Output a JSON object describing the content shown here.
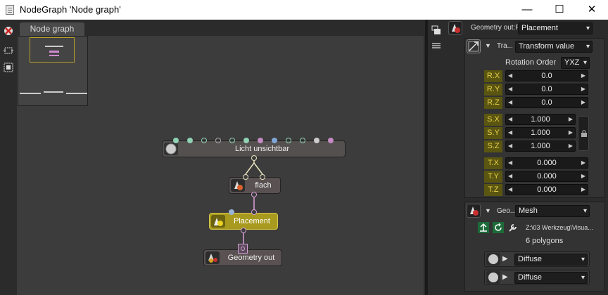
{
  "window": {
    "title": "NodeGraph 'Node graph'",
    "minimize": "—",
    "maximize": "☐",
    "close": "✕"
  },
  "graph": {
    "tab_label": "Node graph",
    "nodes": {
      "licht": "Licht unsichtbar",
      "flach": "flach",
      "placement": "Placement",
      "geometry_out": "Geometry out"
    }
  },
  "inspector": {
    "node_label": "Geometry out:P...",
    "node_value": "Placement",
    "transform": {
      "label": "Tra...",
      "value": "Transform value",
      "rotation_order_label": "Rotation Order",
      "rotation_order_value": "YXZ"
    },
    "params": [
      {
        "label": "R.X",
        "value": "0.0"
      },
      {
        "label": "R.Y",
        "value": "0.0"
      },
      {
        "label": "R.Z",
        "value": "0.0"
      },
      {
        "label": "S.X",
        "value": "1.000"
      },
      {
        "label": "S.Y",
        "value": "1.000"
      },
      {
        "label": "S.Z",
        "value": "1.000"
      },
      {
        "label": "T.X",
        "value": "0.000"
      },
      {
        "label": "T.Y",
        "value": "0.000"
      },
      {
        "label": "T.Z",
        "value": "0.000"
      }
    ],
    "geometry": {
      "label": "Geo...",
      "value": "Mesh",
      "path": "Z:\\03 Werkzeug\\Visua...",
      "polygons": "6 polygons"
    },
    "materials": [
      {
        "value": "Diffuse"
      },
      {
        "value": "Diffuse"
      }
    ]
  },
  "colors": {
    "accent_yellow": "#a89a1e",
    "pin_pink": "#c58ac4",
    "pin_green": "#8fd2b4",
    "pin_blue": "#7fa6d6"
  }
}
